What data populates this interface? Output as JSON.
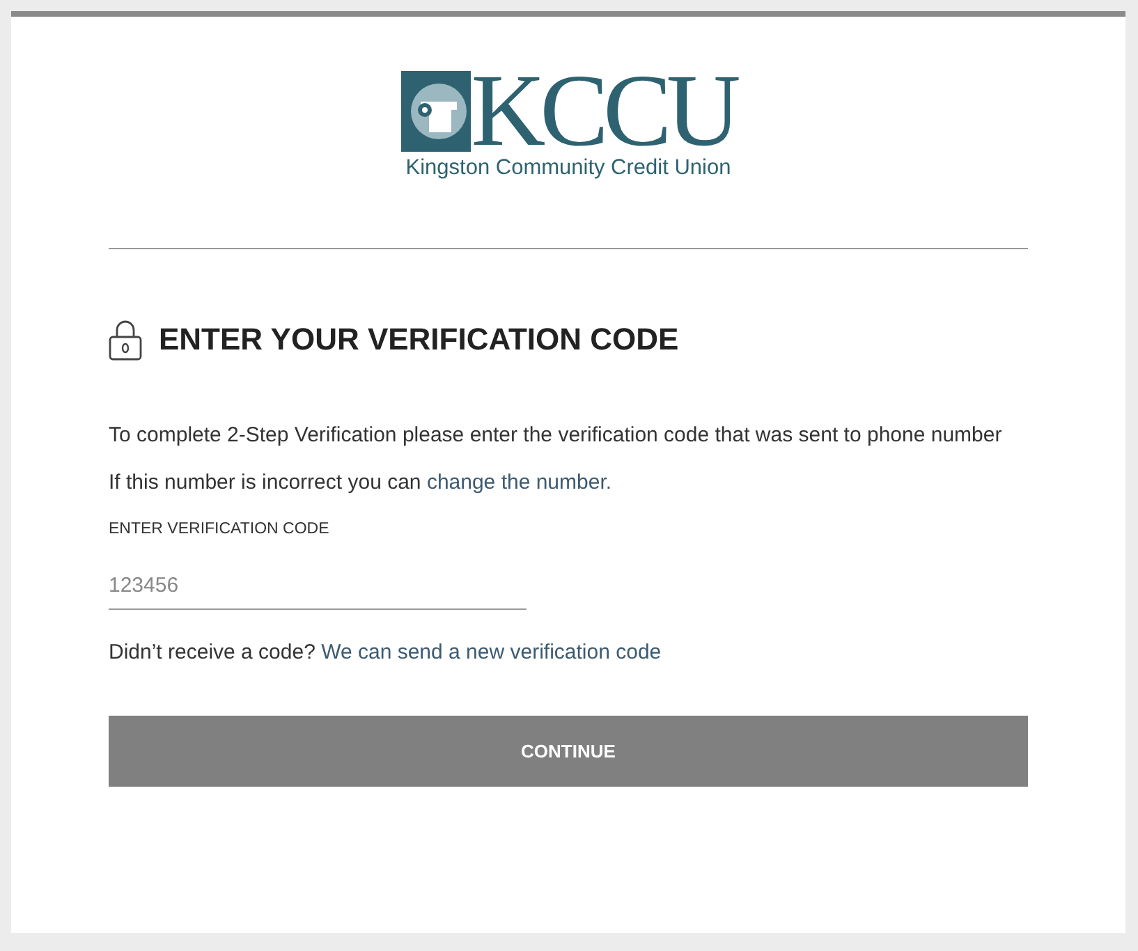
{
  "logo": {
    "wordmark": "KCCU",
    "tagline": "Kingston Community Credit Union"
  },
  "heading": "ENTER YOUR VERIFICATION CODE",
  "intro": "To complete 2-Step Verification please enter the verification code that was sent to phone number",
  "change_line": {
    "text": "If this number is incorrect you can",
    "link": "change the number."
  },
  "code_field": {
    "label": "ENTER VERIFICATION CODE",
    "placeholder": "123456"
  },
  "resend_line": {
    "text": "Didn’t receive a code?",
    "link": "We can send a new verification code"
  },
  "continue_button": {
    "label": "CONTINUE",
    "disabled": true
  }
}
